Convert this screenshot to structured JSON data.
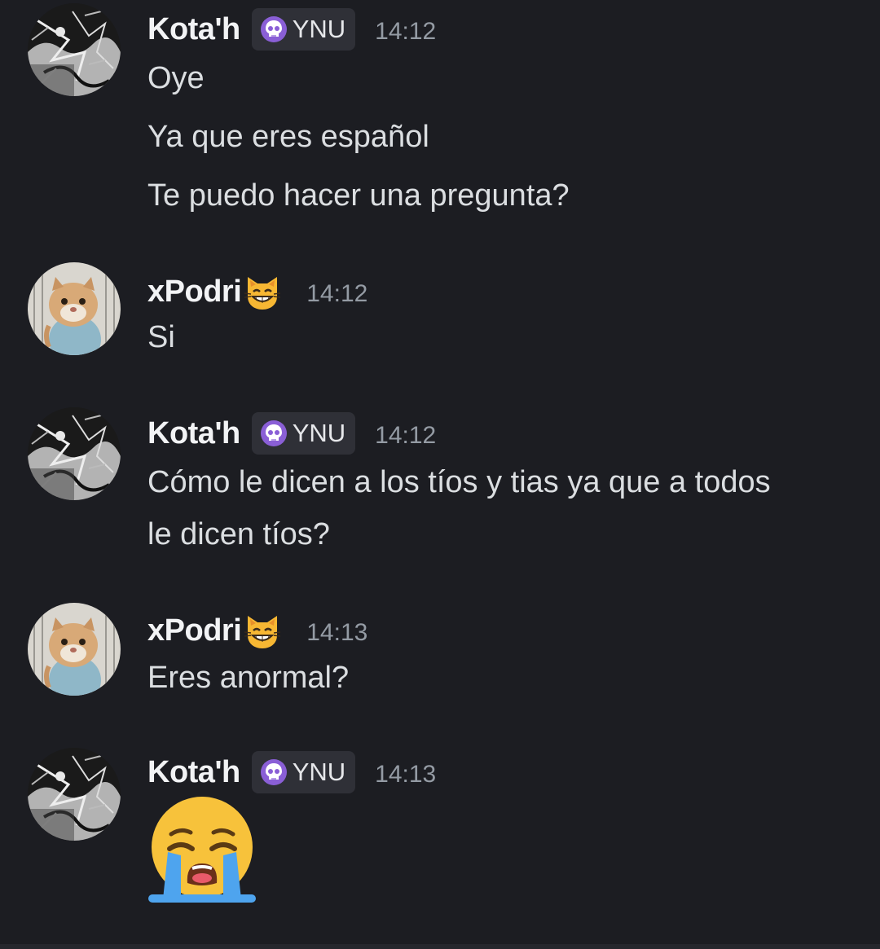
{
  "messages": [
    {
      "username": "Kota'h",
      "tag": "YNU",
      "time": "14:12",
      "lines": [
        "Oye",
        "Ya que eres español",
        "Te puedo hacer una pregunta?"
      ]
    },
    {
      "username": "xPodri",
      "time": "14:12",
      "lines": [
        "Si"
      ]
    },
    {
      "username": "Kota'h",
      "tag": "YNU",
      "time": "14:12",
      "lines": [
        "Cómo le dicen a los tíos y tias ya que a todos",
        "le dicen tíos?"
      ]
    },
    {
      "username": "xPodri",
      "time": "14:13",
      "lines": [
        "Eres anormal?"
      ]
    },
    {
      "username": "Kota'h",
      "tag": "YNU",
      "time": "14:13",
      "emoji": "loudly-crying-face-icon"
    }
  ],
  "icons": {
    "tag_icon": "skull-icon",
    "user_emoji": "grinning-cat-icon"
  },
  "colors": {
    "background": "#1c1d22",
    "username": "#f2f3f5",
    "message_text": "#dbdee1",
    "timestamp": "#949ba4",
    "tag_background": "#2f3037",
    "skull_purple": "#a07be6"
  }
}
